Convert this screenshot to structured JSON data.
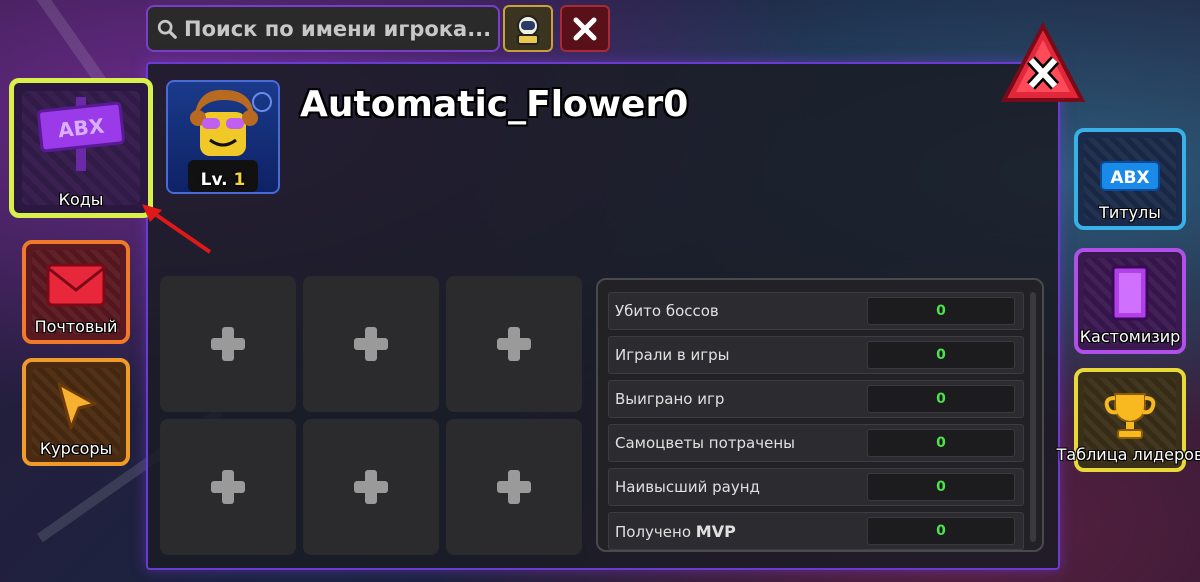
{
  "search": {
    "placeholder": "Поиск по имени игрока..."
  },
  "profile": {
    "username": "Automatic_Flower0",
    "level_prefix": "Lv.",
    "level": "1"
  },
  "left_menu": {
    "codes": {
      "label": "Коды",
      "sign_text": "ABX"
    },
    "mail": {
      "label": "Почтовый"
    },
    "cursors": {
      "label": "Курсоры"
    }
  },
  "right_menu": {
    "titles": {
      "label": "Титулы",
      "badge_text": "ABX"
    },
    "customizer": {
      "label": "Кастомизир"
    },
    "leaderboard": {
      "label": "Таблица лидеров"
    }
  },
  "stats": [
    {
      "label": "Убито боссов",
      "value": "0"
    },
    {
      "label": "Играли в игры",
      "value": "0"
    },
    {
      "label": "Выиграно игр",
      "value": "0"
    },
    {
      "label": "Самоцветы потрачены",
      "value": "0"
    },
    {
      "label": "Наивысший раунд",
      "value": "0"
    },
    {
      "label_prefix": "Получено",
      "label_bold": "MVP",
      "value": "0"
    }
  ],
  "colors": {
    "panel_border": "#6b3ad1",
    "stat_value": "#4ee04e",
    "codes_border": "#d8f04a",
    "close_red": "#e0283a"
  },
  "icons": [
    "search-icon",
    "astronaut-icon",
    "close-icon",
    "plus-icon",
    "mail-icon",
    "cursor-icon",
    "trophy-icon"
  ]
}
